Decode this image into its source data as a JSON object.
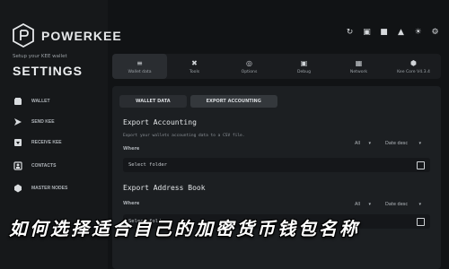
{
  "brand": {
    "name": "POWERKEE"
  },
  "sidebar": {
    "subtitle": "Setup your KEE wallet",
    "title": "SETTINGS",
    "items": [
      {
        "label": "WALLET",
        "icon": "wallet-icon"
      },
      {
        "label": "SEND KEE",
        "icon": "send-icon"
      },
      {
        "label": "RECEIVE KEE",
        "icon": "receive-icon"
      },
      {
        "label": "CONTACTS",
        "icon": "contacts-icon"
      },
      {
        "label": "MASTER NODES",
        "icon": "master-nodes-icon"
      },
      {
        "label": "",
        "icon": "more-icon"
      }
    ]
  },
  "toolbar": {
    "tabs": [
      {
        "label": "Wallet data",
        "icon": "database-icon"
      },
      {
        "label": "Tools",
        "icon": "tools-icon"
      },
      {
        "label": "Options",
        "icon": "options-icon"
      },
      {
        "label": "Debug",
        "icon": "debug-icon"
      },
      {
        "label": "Network",
        "icon": "network-icon"
      },
      {
        "label": "Kee Core V4.3.4",
        "icon": "core-icon"
      }
    ]
  },
  "subtabs": [
    "WALLET DATA",
    "EXPORT ACCOUNTING"
  ],
  "export_accounting": {
    "title": "Export Accounting",
    "description": "Export your wallets accounting data to a CSV file.",
    "where_label": "Where",
    "filter": "All",
    "sort": "Date desc",
    "field_value": "Select folder"
  },
  "export_address_book": {
    "title": "Export Address Book",
    "where_label": "Where",
    "filter": "All",
    "sort": "Date desc",
    "field_value": "Select folder"
  },
  "overlay": {
    "text": "如何选择适合自己的加密货币钱包名称"
  },
  "colors": {
    "background": "#111315",
    "panel": "#1c1f22",
    "text": "#cfd3d6"
  }
}
